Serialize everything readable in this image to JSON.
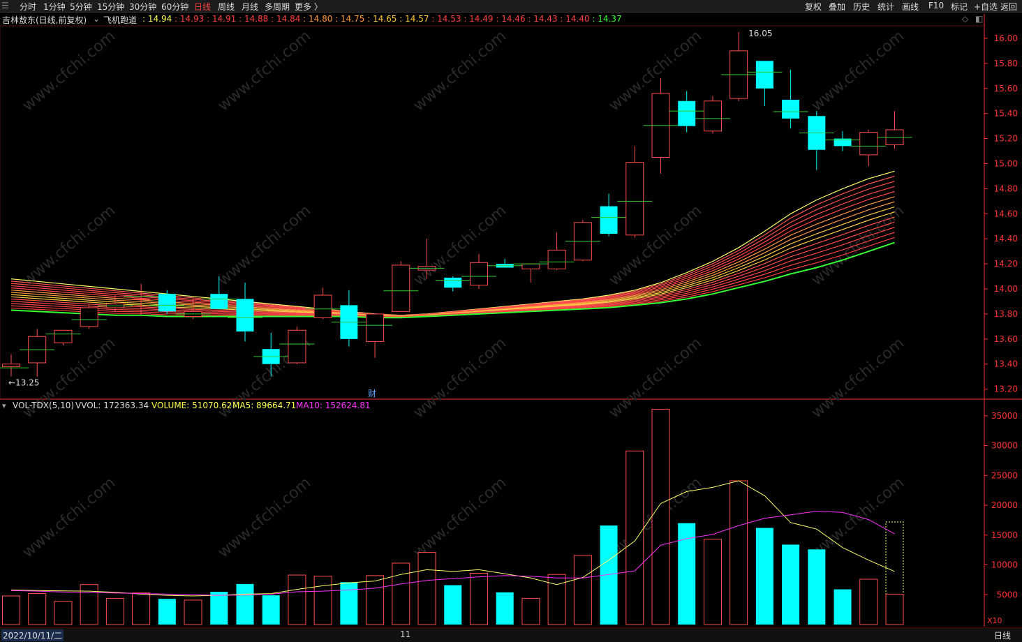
{
  "toolbar": {
    "left": [
      "分时",
      "1分钟",
      "5分钟",
      "15分钟",
      "30分钟",
      "60分钟",
      "日线",
      "周线",
      "月线",
      "多周期",
      "更多 〉"
    ],
    "active": "日线",
    "right": [
      "复权",
      "叠加",
      "历史",
      "统计",
      "画线",
      "F10",
      "标记",
      "+自选",
      "返回"
    ]
  },
  "info": {
    "stock": "吉林敖东(日线,前复权)",
    "indicator": "飞机跑道",
    "values": [
      {
        "v": "14.94",
        "c": "#ffff4d"
      },
      {
        "v": "14.93",
        "c": "#ff4040"
      },
      {
        "v": "14.91",
        "c": "#ff4040"
      },
      {
        "v": "14.88",
        "c": "#ff4040"
      },
      {
        "v": "14.84",
        "c": "#ff4040"
      },
      {
        "v": "14.80",
        "c": "#ff9933"
      },
      {
        "v": "14.75",
        "c": "#ff9933"
      },
      {
        "v": "14.65",
        "c": "#ffcc33"
      },
      {
        "v": "14.57",
        "c": "#ffcc33"
      },
      {
        "v": "14.53",
        "c": "#ff4040"
      },
      {
        "v": "14.49",
        "c": "#ff4040"
      },
      {
        "v": "14.46",
        "c": "#ff4040"
      },
      {
        "v": "14.43",
        "c": "#ff4040"
      },
      {
        "v": "14.40",
        "c": "#ff4040"
      },
      {
        "v": "14.37",
        "c": "#33ff33"
      }
    ]
  },
  "vol_info": {
    "name": "VOL-TDX(5,10)",
    "vvol": "VVOL: 172363.34",
    "volume": "VOLUME: 51070.62",
    "ma5": "MA5: 89664.71",
    "ma10": "MA10: 152624.81"
  },
  "annotations": {
    "high": "16.05",
    "low": "←13.25",
    "fin_marker": "财",
    "x10": "X10"
  },
  "bottom": {
    "date": "2022/10/11/二",
    "month": "11",
    "period": "日线"
  },
  "watermark": "www.cfchi.com",
  "colors": {
    "up": "#ff4d4d",
    "down": "#00ffff",
    "axis": "#ff3333",
    "ma5": "#ffff66",
    "ma10": "#ff33ff"
  },
  "chart_data": [
    {
      "type": "candlestick",
      "y_ticks": [
        13.2,
        13.4,
        13.6,
        13.8,
        14.0,
        14.2,
        14.4,
        14.6,
        14.8,
        15.0,
        15.2,
        15.4,
        15.6,
        15.8,
        16.0
      ],
      "ylim": [
        13.12,
        16.1
      ],
      "candles": [
        {
          "o": 13.38,
          "h": 13.48,
          "l": 13.3,
          "c": 13.4
        },
        {
          "o": 13.41,
          "h": 13.68,
          "l": 13.3,
          "c": 13.62
        },
        {
          "o": 13.57,
          "h": 13.67,
          "l": 13.55,
          "c": 13.67
        },
        {
          "o": 13.7,
          "h": 13.88,
          "l": 13.68,
          "c": 13.85
        },
        {
          "o": 13.85,
          "h": 13.95,
          "l": 13.82,
          "c": 13.88
        },
        {
          "o": 13.92,
          "h": 14.04,
          "l": 13.79,
          "c": 13.92
        },
        {
          "o": 13.96,
          "h": 13.99,
          "l": 13.8,
          "c": 13.82
        },
        {
          "o": 13.78,
          "h": 13.92,
          "l": 13.76,
          "c": 13.82
        },
        {
          "o": 13.96,
          "h": 14.1,
          "l": 13.84,
          "c": 13.84
        },
        {
          "o": 13.92,
          "h": 14.05,
          "l": 13.58,
          "c": 13.66
        },
        {
          "o": 13.52,
          "h": 13.65,
          "l": 13.3,
          "c": 13.4
        },
        {
          "o": 13.41,
          "h": 13.7,
          "l": 13.4,
          "c": 13.67
        },
        {
          "o": 13.77,
          "h": 14.01,
          "l": 13.76,
          "c": 13.95
        },
        {
          "o": 13.87,
          "h": 13.99,
          "l": 13.54,
          "c": 13.6
        },
        {
          "o": 13.58,
          "h": 13.8,
          "l": 13.45,
          "c": 13.8
        },
        {
          "o": 13.82,
          "h": 14.22,
          "l": 13.82,
          "c": 14.19
        },
        {
          "o": 14.15,
          "h": 14.4,
          "l": 14.08,
          "c": 14.18
        },
        {
          "o": 14.09,
          "h": 14.1,
          "l": 13.98,
          "c": 14.01
        },
        {
          "o": 14.03,
          "h": 14.28,
          "l": 14.0,
          "c": 14.21
        },
        {
          "o": 14.2,
          "h": 14.24,
          "l": 14.17,
          "c": 14.17
        },
        {
          "o": 14.16,
          "h": 14.2,
          "l": 14.05,
          "c": 14.2
        },
        {
          "o": 14.16,
          "h": 14.45,
          "l": 14.15,
          "c": 14.31
        },
        {
          "o": 14.23,
          "h": 14.55,
          "l": 14.22,
          "c": 14.53
        },
        {
          "o": 14.66,
          "h": 14.76,
          "l": 14.42,
          "c": 14.44
        },
        {
          "o": 14.43,
          "h": 15.14,
          "l": 14.41,
          "c": 15.01
        },
        {
          "o": 15.05,
          "h": 15.68,
          "l": 14.92,
          "c": 15.56
        },
        {
          "o": 15.5,
          "h": 15.58,
          "l": 15.25,
          "c": 15.3
        },
        {
          "o": 15.26,
          "h": 15.54,
          "l": 15.24,
          "c": 15.5
        },
        {
          "o": 15.52,
          "h": 16.05,
          "l": 15.5,
          "c": 15.9
        },
        {
          "o": 15.82,
          "h": 15.82,
          "l": 15.46,
          "c": 15.6
        },
        {
          "o": 15.51,
          "h": 15.75,
          "l": 15.28,
          "c": 15.36
        },
        {
          "o": 15.38,
          "h": 15.42,
          "l": 14.95,
          "c": 15.11
        },
        {
          "o": 15.2,
          "h": 15.26,
          "l": 15.1,
          "c": 15.14
        },
        {
          "o": 15.07,
          "h": 15.27,
          "l": 14.98,
          "c": 15.25
        },
        {
          "o": 15.15,
          "h": 15.42,
          "l": 15.12,
          "c": 15.27
        }
      ],
      "runway_first": [
        14.08,
        14.06,
        14.04,
        14.02,
        14.0,
        13.98,
        13.96,
        13.94,
        13.92,
        13.9,
        13.88,
        13.86,
        13.84,
        13.82,
        13.8,
        13.79,
        13.8,
        13.82,
        13.84,
        13.86,
        13.88,
        13.9,
        13.92,
        13.95,
        13.99,
        14.05,
        14.13,
        14.22,
        14.33,
        14.46,
        14.6,
        14.71,
        14.8,
        14.88,
        14.94
      ],
      "runway_last": [
        13.83,
        13.82,
        13.81,
        13.8,
        13.79,
        13.79,
        13.78,
        13.78,
        13.78,
        13.78,
        13.78,
        13.78,
        13.78,
        13.78,
        13.77,
        13.77,
        13.78,
        13.79,
        13.8,
        13.81,
        13.82,
        13.83,
        13.84,
        13.85,
        13.87,
        13.89,
        13.92,
        13.96,
        14.01,
        14.06,
        14.12,
        14.17,
        14.23,
        14.3,
        14.37
      ]
    },
    {
      "type": "bar",
      "y_ticks": [
        5000,
        10000,
        15000,
        20000,
        25000,
        30000,
        35000
      ],
      "ylim": [
        0,
        36500
      ],
      "volume": [
        4800,
        5200,
        3900,
        6700,
        4400,
        5300,
        4300,
        4100,
        5500,
        6800,
        4900,
        8300,
        8100,
        7100,
        8200,
        10300,
        12100,
        6600,
        8600,
        5400,
        4400,
        8400,
        11600,
        16600,
        29100,
        36100,
        17000,
        14300,
        24100,
        16200,
        13400,
        12600,
        5900,
        7600,
        5100
      ],
      "ma5": [
        5800,
        5700,
        5650,
        5600,
        5400,
        5100,
        4900,
        4800,
        4900,
        5100,
        5200,
        5900,
        6500,
        7000,
        7300,
        8400,
        9200,
        8900,
        9200,
        8500,
        7800,
        6700,
        7900,
        10800,
        14000,
        20300,
        22300,
        23000,
        24100,
        21600,
        17100,
        16000,
        12900,
        10800,
        8900
      ],
      "ma10": [
        5700,
        5600,
        5450,
        5350,
        5300,
        5200,
        5100,
        5000,
        4900,
        4950,
        5100,
        5500,
        5600,
        5800,
        6100,
        6800,
        7400,
        7700,
        8000,
        8200,
        8100,
        7800,
        7800,
        8400,
        9000,
        13300,
        14400,
        15100,
        16600,
        17800,
        18400,
        19000,
        18800,
        17600,
        15200
      ]
    }
  ]
}
